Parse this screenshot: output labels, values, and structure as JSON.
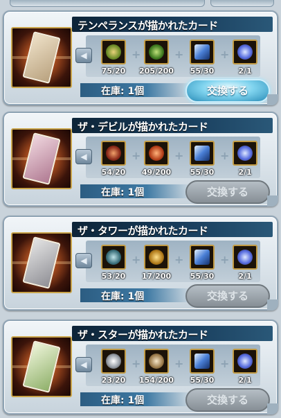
{
  "stock_label": "在庫: 1個",
  "exchange_label": "交換する",
  "colors": {
    "title_bar": "#183d5c",
    "button_active": "#7fd3ee",
    "button_disabled": "#9aa3aa"
  },
  "cards": [
    {
      "title": "テンペランスが描かれたカード",
      "card_color": "#d9c9b3",
      "button_state": "active",
      "materials": [
        {
          "icon": "green-crest-icon",
          "count": "75/20"
        },
        {
          "icon": "green-orb-icon",
          "count": "205/200"
        },
        {
          "icon": "blue-crystal-icon",
          "count": "55/30"
        },
        {
          "icon": "blue-gem-icon",
          "count": "2/1"
        }
      ]
    },
    {
      "title": "ザ・デビルが描かれたカード",
      "card_color": "#d7b6c4",
      "button_state": "disabled",
      "materials": [
        {
          "icon": "red-crest-icon",
          "count": "54/20"
        },
        {
          "icon": "red-orb-icon",
          "count": "49/200"
        },
        {
          "icon": "blue-crystal-icon",
          "count": "55/30"
        },
        {
          "icon": "blue-gem-icon",
          "count": "2/1"
        }
      ]
    },
    {
      "title": "ザ・タワーが描かれたカード",
      "card_color": "#c7c7c7",
      "button_state": "disabled",
      "materials": [
        {
          "icon": "teal-crest-icon",
          "count": "53/20"
        },
        {
          "icon": "gold-orb-icon",
          "count": "17/200"
        },
        {
          "icon": "blue-crystal-icon",
          "count": "55/30"
        },
        {
          "icon": "blue-gem-icon",
          "count": "2/1"
        }
      ]
    },
    {
      "title": "ザ・スターが描かれたカード",
      "card_color": "#cfe0b8",
      "button_state": "disabled",
      "materials": [
        {
          "icon": "white-crest-icon",
          "count": "23/20"
        },
        {
          "icon": "silver-orb-icon",
          "count": "154/200"
        },
        {
          "icon": "blue-crystal-icon",
          "count": "55/30"
        },
        {
          "icon": "blue-gem-icon",
          "count": "2/1"
        }
      ]
    }
  ]
}
